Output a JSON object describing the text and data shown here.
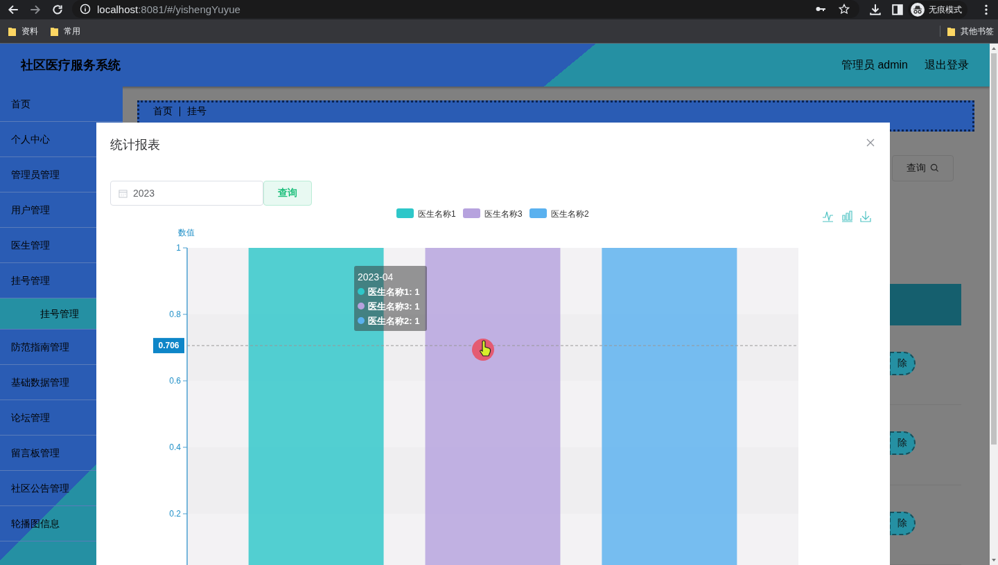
{
  "browser": {
    "url_host": "localhost",
    "url_path": ":8081/#/yishengYuyue",
    "profile_label": "无痕模式",
    "bookmarks": [
      "资料",
      "常用"
    ],
    "other_bookmarks": "其他书签"
  },
  "header": {
    "title": "社区医疗服务系统",
    "user": "管理员 admin",
    "logout": "退出登录"
  },
  "sidebar": {
    "items": [
      {
        "label": "首页",
        "selected": false
      },
      {
        "label": "个人中心",
        "selected": false
      },
      {
        "label": "管理员管理",
        "selected": false
      },
      {
        "label": "用户管理",
        "selected": false
      },
      {
        "label": "医生管理",
        "selected": false
      },
      {
        "label": "挂号管理",
        "selected": false,
        "expanded": true,
        "children": [
          {
            "label": "挂号管理",
            "selected": true
          }
        ]
      },
      {
        "label": "防范指南管理",
        "selected": false
      },
      {
        "label": "基础数据管理",
        "selected": false
      },
      {
        "label": "论坛管理",
        "selected": false
      },
      {
        "label": "留言板管理",
        "selected": false
      },
      {
        "label": "社区公告管理",
        "selected": false
      },
      {
        "label": "轮播图信息",
        "selected": false
      }
    ]
  },
  "background": {
    "breadcrumb": [
      "首页",
      "挂号"
    ],
    "search_button": "查询",
    "delete_buttons": [
      "除",
      "除",
      "除"
    ]
  },
  "dialog": {
    "title": "统计报表",
    "date_value": "2023",
    "query_button": "查询",
    "chart_data": {
      "type": "bar",
      "ylabel": "数值",
      "legend": "top",
      "ref_lines": [
        {
          "axis": "y",
          "value": 0.706,
          "label": "0.706"
        }
      ],
      "ylim": [
        0,
        1
      ],
      "yticks": [
        0.2,
        0.4,
        0.6,
        0.8,
        1
      ],
      "series": [
        {
          "name": "医生名称1",
          "color": "#2ec7c9",
          "values": [
            1
          ]
        },
        {
          "name": "医生名称3",
          "color": "#b6a2de",
          "values": [
            1
          ]
        },
        {
          "name": "医生名称2",
          "color": "#5ab1ef",
          "values": [
            1
          ]
        }
      ]
    },
    "tooltip": {
      "title": "2023-04",
      "rows": [
        "医生名称1: 1",
        "医生名称3: 1",
        "医生名称2: 1"
      ]
    }
  }
}
